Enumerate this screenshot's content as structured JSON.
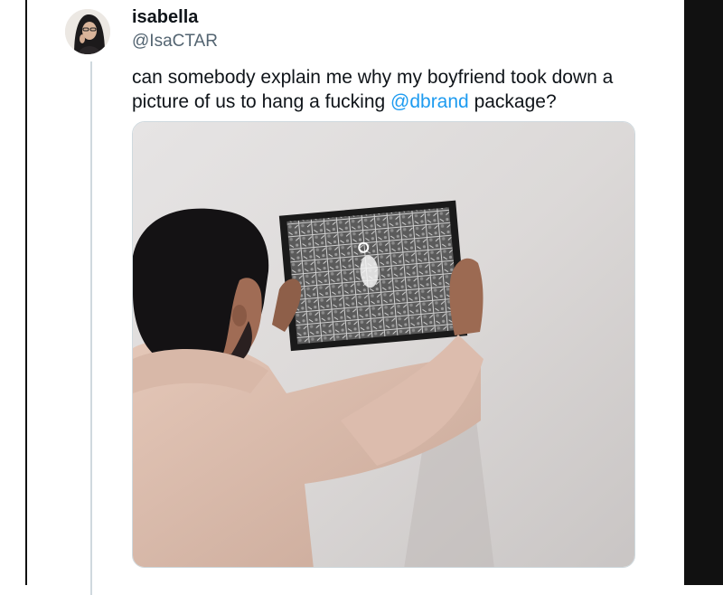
{
  "tweet": {
    "display_name": "isabella",
    "handle": "@IsaCTAR",
    "text_before": "can somebody explain me why my boyfriend took down a picture of us to hang a fucking ",
    "mention": "@dbrand",
    "text_after": " package?"
  },
  "icons": {
    "avatar": "profile-photo",
    "media": "photo-man-hanging-framed-map"
  },
  "colors": {
    "mention": "#1d9bf0",
    "handle": "#536471",
    "text": "#0f1419"
  }
}
